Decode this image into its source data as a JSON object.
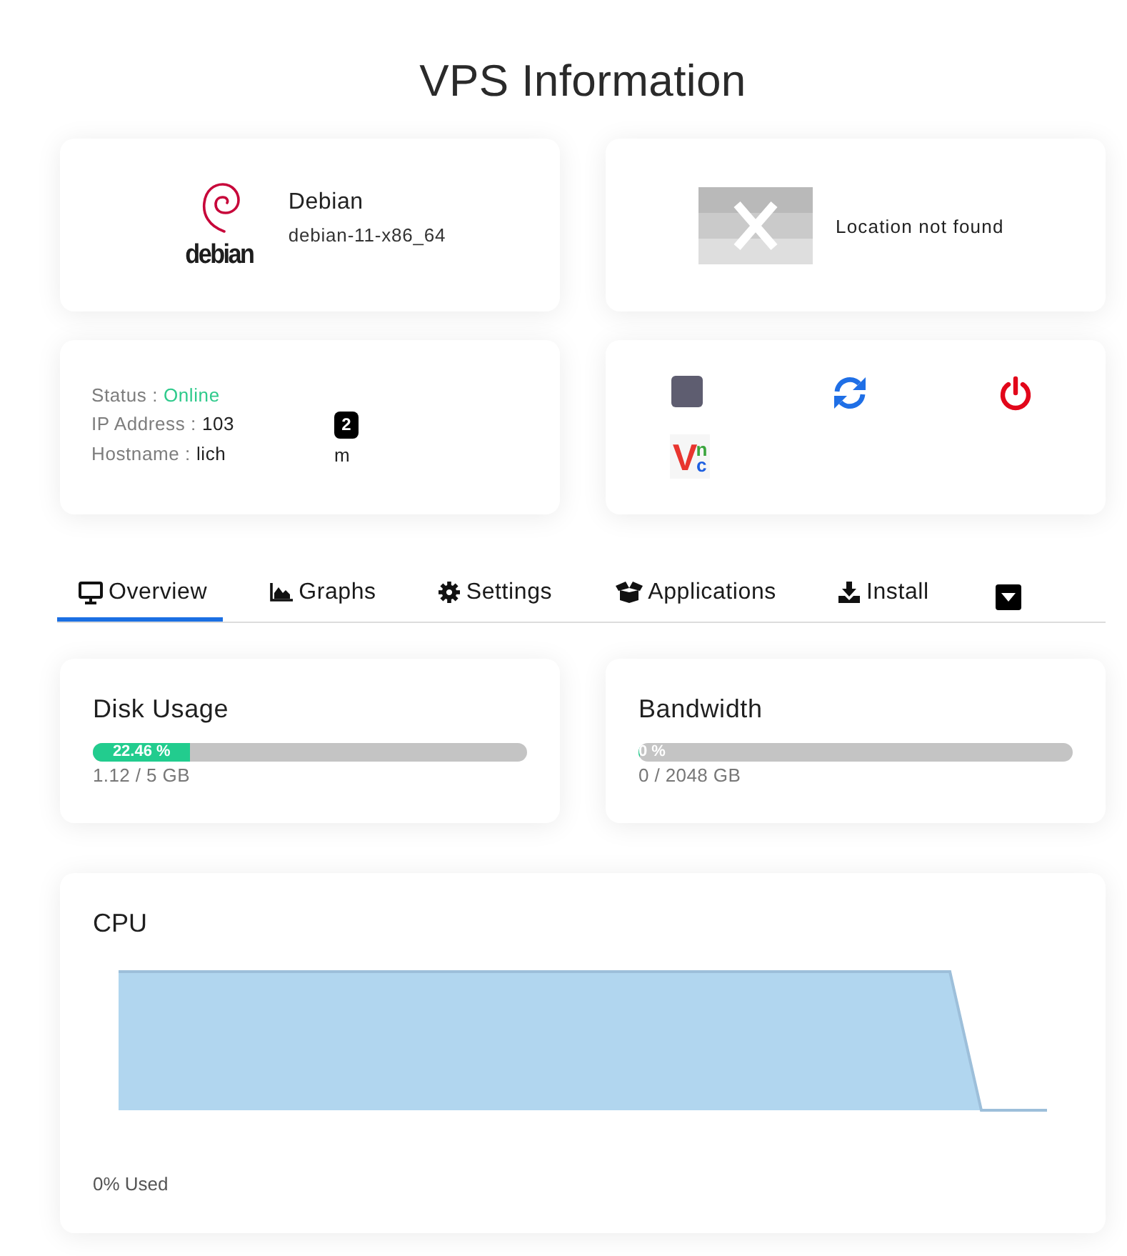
{
  "page": {
    "title": "VPS Information"
  },
  "os_card": {
    "logo_text": "debian",
    "name": "Debian",
    "template": "debian-11-x86_64"
  },
  "location_card": {
    "message": "Location not found"
  },
  "status_card": {
    "rows": [
      {
        "kind": "status",
        "label": "Status :",
        "value": "Online"
      },
      {
        "kind": "plain",
        "label": "IP Address :",
        "value": "103",
        "trailing": {
          "kind": "badge",
          "text": "2"
        }
      },
      {
        "kind": "plain",
        "label": "Hostname :",
        "value": "lich",
        "trailing": {
          "kind": "plain",
          "text": "m"
        }
      }
    ]
  },
  "actions": [
    {
      "kind": "stop"
    },
    {
      "kind": "restart"
    },
    {
      "kind": "power"
    },
    {
      "kind": "vnc",
      "letters": [
        "V",
        "n",
        "c"
      ]
    }
  ],
  "tabs": [
    {
      "label": "Overview",
      "selected": true
    },
    {
      "label": "Graphs",
      "selected": false
    },
    {
      "label": "Settings",
      "selected": false
    },
    {
      "label": "Applications",
      "selected": false
    },
    {
      "label": "Install",
      "selected": false
    }
  ],
  "usage": [
    {
      "title": "Disk Usage",
      "level": 0.2246,
      "label": "22.46 %",
      "reading": "1.12 / 5 GB"
    },
    {
      "title": "Bandwidth",
      "level": 0,
      "label": "0 %",
      "reading": "0 / 2048 GB"
    }
  ],
  "cpu": {
    "title": "CPU",
    "footer": "0% Used"
  }
}
